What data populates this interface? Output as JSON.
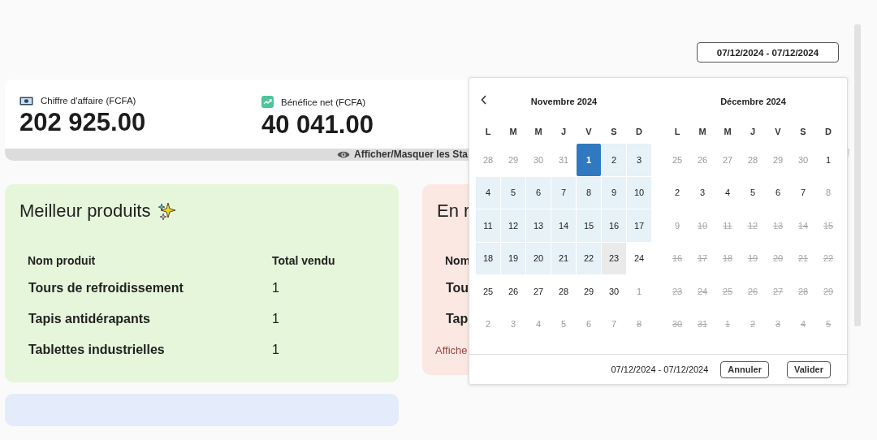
{
  "date_range_button": {
    "label": "07/12/2024 - 07/12/2024"
  },
  "stats": {
    "items": [
      {
        "kind": "money",
        "label": "Chiffre d'affaire (FCFA)",
        "value": "202 925.00"
      },
      {
        "kind": "trend",
        "label": "Bénéfice net (FCFA)",
        "value": "40 041.00"
      }
    ],
    "toggle_label": "Afficher/Masquer les Sta"
  },
  "best_products": {
    "title": "Meilleur produits",
    "columns": [
      "Nom produit",
      "Total vendu"
    ],
    "rows": [
      [
        "Tours de refroidissement",
        "1"
      ],
      [
        "Tapis antidérapants",
        "1"
      ],
      [
        "Tablettes industrielles",
        "1"
      ]
    ]
  },
  "restock_card": {
    "title": "En r",
    "column": "Nom",
    "rows": [
      "Tou",
      "Tap"
    ],
    "link": "Affiche"
  },
  "date_picker": {
    "months": [
      {
        "title": "Novembre 2024",
        "weekdays": [
          "L",
          "M",
          "M",
          "J",
          "V",
          "S",
          "D"
        ],
        "weeks": [
          [
            {
              "day": "28",
              "kind": "outside",
              "selected": false,
              "in_range": false,
              "hovered": false
            },
            {
              "day": "29",
              "kind": "outside",
              "selected": false,
              "in_range": false,
              "hovered": false
            },
            {
              "day": "30",
              "kind": "outside",
              "selected": false,
              "in_range": false,
              "hovered": false
            },
            {
              "day": "31",
              "kind": "outside",
              "selected": false,
              "in_range": false,
              "hovered": false
            },
            {
              "day": "1",
              "kind": "normal",
              "selected": true,
              "in_range": false,
              "hovered": false
            },
            {
              "day": "2",
              "kind": "normal",
              "selected": false,
              "in_range": true,
              "hovered": false
            },
            {
              "day": "3",
              "kind": "normal",
              "selected": false,
              "in_range": true,
              "hovered": false
            }
          ],
          [
            {
              "day": "4",
              "kind": "normal",
              "selected": false,
              "in_range": true,
              "hovered": false
            },
            {
              "day": "5",
              "kind": "normal",
              "selected": false,
              "in_range": true,
              "hovered": false
            },
            {
              "day": "6",
              "kind": "normal",
              "selected": false,
              "in_range": true,
              "hovered": false
            },
            {
              "day": "7",
              "kind": "normal",
              "selected": false,
              "in_range": true,
              "hovered": false
            },
            {
              "day": "8",
              "kind": "normal",
              "selected": false,
              "in_range": true,
              "hovered": false
            },
            {
              "day": "9",
              "kind": "normal",
              "selected": false,
              "in_range": true,
              "hovered": false
            },
            {
              "day": "10",
              "kind": "normal",
              "selected": false,
              "in_range": true,
              "hovered": false
            }
          ],
          [
            {
              "day": "11",
              "kind": "normal",
              "selected": false,
              "in_range": true,
              "hovered": false
            },
            {
              "day": "12",
              "kind": "normal",
              "selected": false,
              "in_range": true,
              "hovered": false
            },
            {
              "day": "13",
              "kind": "normal",
              "selected": false,
              "in_range": true,
              "hovered": false
            },
            {
              "day": "14",
              "kind": "normal",
              "selected": false,
              "in_range": true,
              "hovered": false
            },
            {
              "day": "15",
              "kind": "normal",
              "selected": false,
              "in_range": true,
              "hovered": false
            },
            {
              "day": "16",
              "kind": "normal",
              "selected": false,
              "in_range": true,
              "hovered": false
            },
            {
              "day": "17",
              "kind": "normal",
              "selected": false,
              "in_range": true,
              "hovered": false
            }
          ],
          [
            {
              "day": "18",
              "kind": "normal",
              "selected": false,
              "in_range": true,
              "hovered": false
            },
            {
              "day": "19",
              "kind": "normal",
              "selected": false,
              "in_range": true,
              "hovered": false
            },
            {
              "day": "20",
              "kind": "normal",
              "selected": false,
              "in_range": true,
              "hovered": false
            },
            {
              "day": "21",
              "kind": "normal",
              "selected": false,
              "in_range": true,
              "hovered": false
            },
            {
              "day": "22",
              "kind": "normal",
              "selected": false,
              "in_range": true,
              "hovered": false
            },
            {
              "day": "23",
              "kind": "normal",
              "selected": false,
              "in_range": false,
              "hovered": true
            },
            {
              "day": "24",
              "kind": "normal",
              "selected": false,
              "in_range": false,
              "hovered": false
            }
          ],
          [
            {
              "day": "25",
              "kind": "normal",
              "selected": false,
              "in_range": false,
              "hovered": false
            },
            {
              "day": "26",
              "kind": "normal",
              "selected": false,
              "in_range": false,
              "hovered": false
            },
            {
              "day": "27",
              "kind": "normal",
              "selected": false,
              "in_range": false,
              "hovered": false
            },
            {
              "day": "28",
              "kind": "normal",
              "selected": false,
              "in_range": false,
              "hovered": false
            },
            {
              "day": "29",
              "kind": "normal",
              "selected": false,
              "in_range": false,
              "hovered": false
            },
            {
              "day": "30",
              "kind": "normal",
              "selected": false,
              "in_range": false,
              "hovered": false
            },
            {
              "day": "1",
              "kind": "outside",
              "selected": false,
              "in_range": false,
              "hovered": false
            }
          ],
          [
            {
              "day": "2",
              "kind": "outside",
              "selected": false,
              "in_range": false,
              "hovered": false
            },
            {
              "day": "3",
              "kind": "outside",
              "selected": false,
              "in_range": false,
              "hovered": false
            },
            {
              "day": "4",
              "kind": "outside",
              "selected": false,
              "in_range": false,
              "hovered": false
            },
            {
              "day": "5",
              "kind": "outside",
              "selected": false,
              "in_range": false,
              "hovered": false
            },
            {
              "day": "6",
              "kind": "outside",
              "selected": false,
              "in_range": false,
              "hovered": false
            },
            {
              "day": "7",
              "kind": "outside",
              "selected": false,
              "in_range": false,
              "hovered": false
            },
            {
              "day": "8",
              "kind": "disabled",
              "selected": false,
              "in_range": false,
              "hovered": false
            }
          ]
        ]
      },
      {
        "title": "Décembre 2024",
        "weekdays": [
          "L",
          "M",
          "M",
          "J",
          "V",
          "S",
          "D"
        ],
        "weeks": [
          [
            {
              "day": "25",
              "kind": "outside",
              "selected": false,
              "in_range": false,
              "hovered": false
            },
            {
              "day": "26",
              "kind": "outside",
              "selected": false,
              "in_range": false,
              "hovered": false
            },
            {
              "day": "27",
              "kind": "outside",
              "selected": false,
              "in_range": false,
              "hovered": false
            },
            {
              "day": "28",
              "kind": "outside",
              "selected": false,
              "in_range": false,
              "hovered": false
            },
            {
              "day": "29",
              "kind": "outside",
              "selected": false,
              "in_range": false,
              "hovered": false
            },
            {
              "day": "30",
              "kind": "outside",
              "selected": false,
              "in_range": false,
              "hovered": false
            },
            {
              "day": "1",
              "kind": "normal",
              "selected": false,
              "in_range": false,
              "hovered": false
            }
          ],
          [
            {
              "day": "2",
              "kind": "normal",
              "selected": false,
              "in_range": false,
              "hovered": false
            },
            {
              "day": "3",
              "kind": "normal",
              "selected": false,
              "in_range": false,
              "hovered": false
            },
            {
              "day": "4",
              "kind": "normal",
              "selected": false,
              "in_range": false,
              "hovered": false
            },
            {
              "day": "5",
              "kind": "normal",
              "selected": false,
              "in_range": false,
              "hovered": false
            },
            {
              "day": "6",
              "kind": "normal",
              "selected": false,
              "in_range": false,
              "hovered": false
            },
            {
              "day": "7",
              "kind": "normal",
              "selected": false,
              "in_range": false,
              "hovered": false
            },
            {
              "day": "8",
              "kind": "outside",
              "selected": false,
              "in_range": false,
              "hovered": false
            }
          ],
          [
            {
              "day": "9",
              "kind": "outside",
              "selected": false,
              "in_range": false,
              "hovered": false
            },
            {
              "day": "10",
              "kind": "disabled",
              "selected": false,
              "in_range": false,
              "hovered": false
            },
            {
              "day": "11",
              "kind": "disabled",
              "selected": false,
              "in_range": false,
              "hovered": false
            },
            {
              "day": "12",
              "kind": "disabled",
              "selected": false,
              "in_range": false,
              "hovered": false
            },
            {
              "day": "13",
              "kind": "disabled",
              "selected": false,
              "in_range": false,
              "hovered": false
            },
            {
              "day": "14",
              "kind": "disabled",
              "selected": false,
              "in_range": false,
              "hovered": false
            },
            {
              "day": "15",
              "kind": "disabled",
              "selected": false,
              "in_range": false,
              "hovered": false
            }
          ],
          [
            {
              "day": "16",
              "kind": "disabled",
              "selected": false,
              "in_range": false,
              "hovered": false
            },
            {
              "day": "17",
              "kind": "disabled",
              "selected": false,
              "in_range": false,
              "hovered": false
            },
            {
              "day": "18",
              "kind": "disabled",
              "selected": false,
              "in_range": false,
              "hovered": false
            },
            {
              "day": "19",
              "kind": "disabled",
              "selected": false,
              "in_range": false,
              "hovered": false
            },
            {
              "day": "20",
              "kind": "disabled",
              "selected": false,
              "in_range": false,
              "hovered": false
            },
            {
              "day": "21",
              "kind": "disabled",
              "selected": false,
              "in_range": false,
              "hovered": false
            },
            {
              "day": "22",
              "kind": "disabled",
              "selected": false,
              "in_range": false,
              "hovered": false
            }
          ],
          [
            {
              "day": "23",
              "kind": "disabled",
              "selected": false,
              "in_range": false,
              "hovered": false
            },
            {
              "day": "24",
              "kind": "disabled",
              "selected": false,
              "in_range": false,
              "hovered": false
            },
            {
              "day": "25",
              "kind": "disabled",
              "selected": false,
              "in_range": false,
              "hovered": false
            },
            {
              "day": "26",
              "kind": "disabled",
              "selected": false,
              "in_range": false,
              "hovered": false
            },
            {
              "day": "27",
              "kind": "disabled",
              "selected": false,
              "in_range": false,
              "hovered": false
            },
            {
              "day": "28",
              "kind": "disabled",
              "selected": false,
              "in_range": false,
              "hovered": false
            },
            {
              "day": "29",
              "kind": "disabled",
              "selected": false,
              "in_range": false,
              "hovered": false
            }
          ],
          [
            {
              "day": "30",
              "kind": "disabled",
              "selected": false,
              "in_range": false,
              "hovered": false
            },
            {
              "day": "31",
              "kind": "disabled",
              "selected": false,
              "in_range": false,
              "hovered": false
            },
            {
              "day": "1",
              "kind": "disabled",
              "selected": false,
              "in_range": false,
              "hovered": false
            },
            {
              "day": "2",
              "kind": "disabled",
              "selected": false,
              "in_range": false,
              "hovered": false
            },
            {
              "day": "3",
              "kind": "disabled",
              "selected": false,
              "in_range": false,
              "hovered": false
            },
            {
              "day": "4",
              "kind": "disabled",
              "selected": false,
              "in_range": false,
              "hovered": false
            },
            {
              "day": "5",
              "kind": "disabled",
              "selected": false,
              "in_range": false,
              "hovered": false
            }
          ]
        ]
      }
    ],
    "footer_range": "07/12/2024 - 07/12/2024",
    "buttons": [
      "Annuler",
      "Valider"
    ]
  }
}
